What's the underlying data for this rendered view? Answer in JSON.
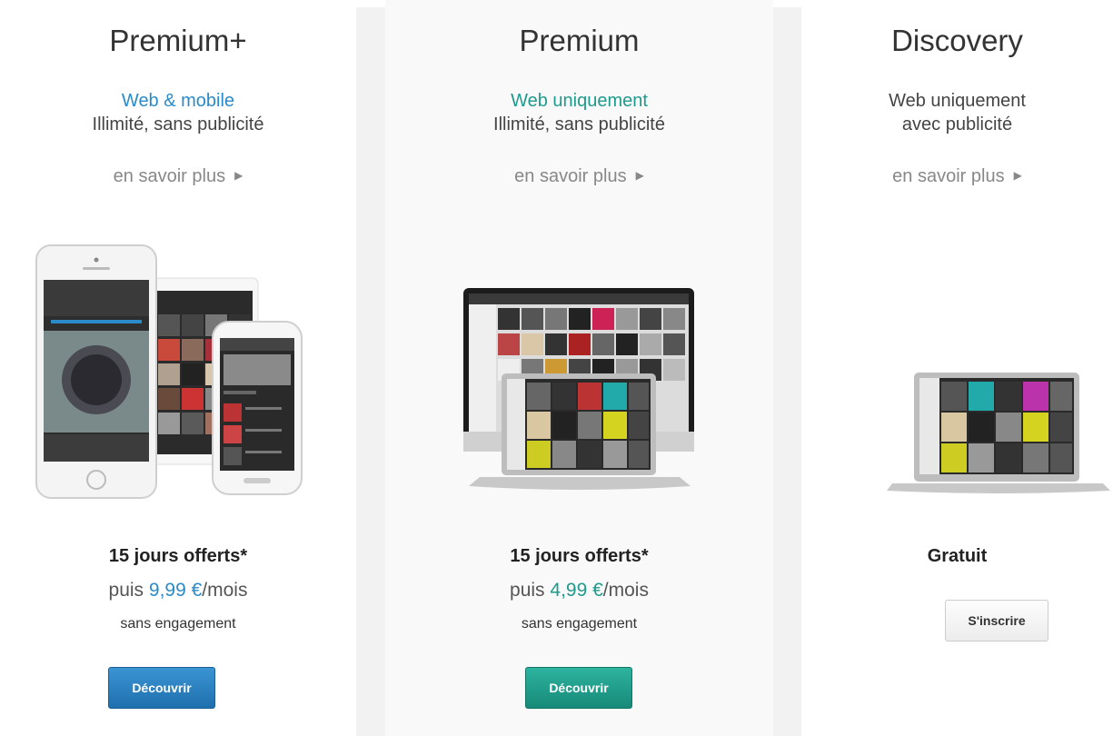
{
  "plans": [
    {
      "title": "Premium+",
      "line1": "Web & mobile",
      "line1_color": "#2a8bc8",
      "line2": "Illimité, sans publicité",
      "more": "en savoir plus",
      "offer": "15 jours offerts*",
      "price_prefix": "puis ",
      "price_amount": "9,99 €",
      "price_suffix": "/mois",
      "commitment": "sans engagement",
      "button": "Découvrir",
      "button_color": "#2378bb"
    },
    {
      "title": "Premium",
      "line1": "Web uniquement",
      "line1_color": "#1f9a8c",
      "line2": "Illimité, sans publicité",
      "more": "en savoir plus",
      "offer": "15 jours offerts*",
      "price_prefix": "puis ",
      "price_amount": "4,99 €",
      "price_suffix": "/mois",
      "commitment": "sans engagement",
      "button": "Découvrir",
      "button_color": "#1a9683"
    },
    {
      "title": "Discovery",
      "line1": "Web uniquement",
      "line1_color": "#444444",
      "line2": "avec publicité",
      "more": "en savoir plus",
      "offer": "Gratuit",
      "button": "S'inscrire",
      "button_color": "#f2f2f2"
    }
  ],
  "icons": {
    "more_arrow": "triangle-right-icon"
  }
}
